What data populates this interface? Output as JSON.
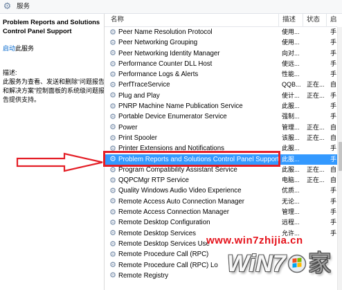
{
  "window": {
    "title": "服务",
    "icon": "services-gear-icon"
  },
  "details": {
    "service_title_lines": [
      "Problem Reports and Solutions",
      "Control Panel Support"
    ],
    "start_link": "启动",
    "start_suffix": "此服务",
    "description_label": "描述:",
    "description_lines": [
      "此服务为查看、发送和删除“问题报告",
      "和解决方案”控制面板的系统级问题报",
      "告提供支持。"
    ]
  },
  "services": {
    "columns": {
      "name": "名称",
      "description": "描述",
      "status": "状态",
      "startup": "启"
    },
    "row_icon": "service-gear-icon",
    "rows": [
      {
        "name": "Peer Name Resolution Protocol",
        "desc": "使用...",
        "start": "手"
      },
      {
        "name": "Peer Networking Grouping",
        "desc": "使用...",
        "start": "手"
      },
      {
        "name": "Peer Networking Identity Manager",
        "desc": "向对...",
        "start": "手"
      },
      {
        "name": "Performance Counter DLL Host",
        "desc": "使远...",
        "start": "手"
      },
      {
        "name": "Performance Logs & Alerts",
        "desc": "性能...",
        "start": "手"
      },
      {
        "name": "PerfTraceService",
        "desc": "QQB...",
        "status": "正在...",
        "start": "自"
      },
      {
        "name": "Plug and Play",
        "desc": "使计...",
        "status": "正在...",
        "start": "手"
      },
      {
        "name": "PNRP Machine Name Publication Service",
        "desc": "此服...",
        "start": "手"
      },
      {
        "name": "Portable Device Enumerator Service",
        "desc": "强制...",
        "start": "手"
      },
      {
        "name": "Power",
        "desc": "管理...",
        "status": "正在...",
        "start": "自"
      },
      {
        "name": "Print Spooler",
        "desc": "该服...",
        "status": "正在...",
        "start": "自"
      },
      {
        "name": "Printer Extensions and Notifications",
        "desc": "此服...",
        "start": "手"
      },
      {
        "name": "Problem Reports and Solutions Control Panel Support",
        "desc": "此服...",
        "start": "手",
        "selected": true
      },
      {
        "name": "Program Compatibility Assistant Service",
        "desc": "此服...",
        "status": "正在...",
        "start": "自"
      },
      {
        "name": "QQPCMgr RTP Service",
        "desc": "电脑...",
        "status": "正在...",
        "start": "自"
      },
      {
        "name": "Quality Windows Audio Video Experience",
        "desc": "优质...",
        "start": "手"
      },
      {
        "name": "Remote Access Auto Connection Manager",
        "desc": "无论...",
        "start": "手"
      },
      {
        "name": "Remote Access Connection Manager",
        "desc": "管理...",
        "start": "手"
      },
      {
        "name": "Remote Desktop Configuration",
        "desc": "远程...",
        "start": "手"
      },
      {
        "name": "Remote Desktop Services",
        "desc": "允许...",
        "start": "手"
      },
      {
        "name": "Remote Desktop Services Use"
      },
      {
        "name": "Remote Procedure Call (RPC)"
      },
      {
        "name": "Remote Procedure Call (RPC) Lo"
      },
      {
        "name": "Remote Registry"
      }
    ]
  },
  "annotations": {
    "arrow_icon": "right-arrow-icon"
  },
  "watermark": {
    "url": "www.win7zhijia.cn",
    "logo_text": "WiN7",
    "logo_char": "家",
    "logo_icon": "windows-flag-icon"
  },
  "colors": {
    "selection": "#3399ff",
    "link": "#0066cc",
    "annotation_red": "#e41e26",
    "watermark_red": "#e5121b"
  }
}
